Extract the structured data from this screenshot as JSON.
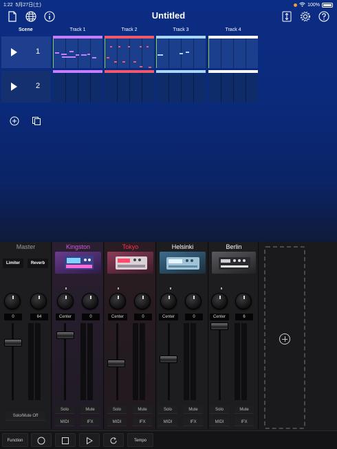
{
  "status_bar": {
    "time": "1:22",
    "date": "5月27日(土)",
    "battery": "100%"
  },
  "title": "Untitled",
  "toolbar": {
    "left_icons": [
      "document-icon",
      "globe-icon",
      "info-icon"
    ],
    "right_icons": [
      "updown-icon",
      "gear-icon",
      "help-icon"
    ]
  },
  "scene_header": "Scene",
  "tracks": [
    {
      "name": "Track 1",
      "color": "#c77dff"
    },
    {
      "name": "Track 2",
      "color": "#f05a6e"
    },
    {
      "name": "Track 3",
      "color": "#a8d8ff"
    },
    {
      "name": "Track 4",
      "color": "#ffffff"
    }
  ],
  "scenes": [
    {
      "number": "1"
    },
    {
      "number": "2"
    }
  ],
  "grid_actions": [
    "add-scene-icon",
    "duplicate-icon"
  ],
  "mixer": {
    "master": {
      "name": "Master",
      "effects": [
        "Limiter",
        "Reverb"
      ],
      "values": [
        "0",
        "64"
      ],
      "button": "Solo/Mute Off"
    },
    "channels": [
      {
        "name": "Kingston",
        "color": "#d05adf",
        "pan": "Center",
        "level": "0",
        "solo": "Solo",
        "mute": "Mute",
        "midi": "MIDI",
        "ifx": "IFX"
      },
      {
        "name": "Tokyo",
        "color": "#ff3050",
        "pan": "Center",
        "level": "0",
        "solo": "Solo",
        "mute": "Mute",
        "midi": "MIDI",
        "ifx": "IFX"
      },
      {
        "name": "Helsinki",
        "color": "#ffffff",
        "pan": "Center",
        "level": "0",
        "solo": "Solo",
        "mute": "Mute",
        "midi": "MIDI",
        "ifx": "IFX"
      },
      {
        "name": "Berlin",
        "color": "#ffffff",
        "pan": "Center",
        "level": "6",
        "solo": "Solo",
        "mute": "Mute",
        "midi": "MIDI",
        "ifx": "IFX"
      }
    ]
  },
  "bottom_bar": {
    "function": "Function",
    "tempo": "Tempo"
  }
}
